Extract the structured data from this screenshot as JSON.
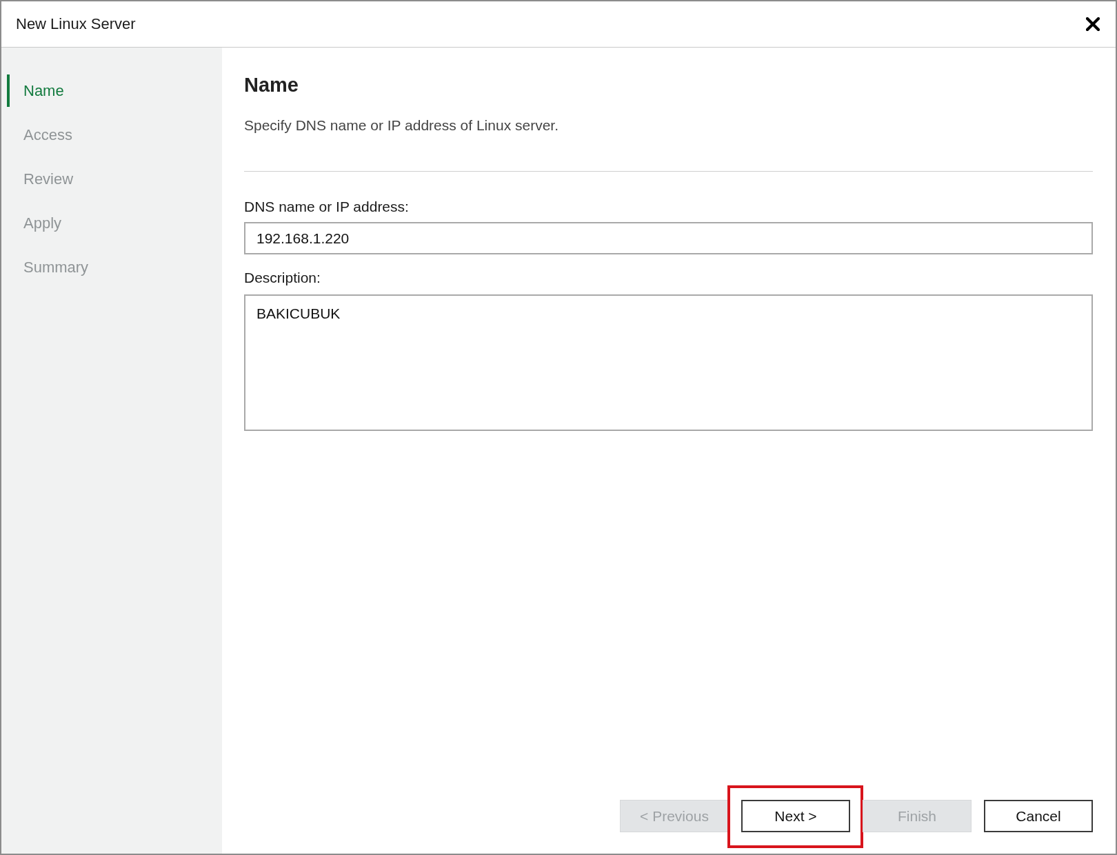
{
  "window": {
    "title": "New Linux Server"
  },
  "steps": [
    {
      "label": "Name",
      "selected": true
    },
    {
      "label": "Access",
      "selected": false
    },
    {
      "label": "Review",
      "selected": false
    },
    {
      "label": "Apply",
      "selected": false
    },
    {
      "label": "Summary",
      "selected": false
    }
  ],
  "page": {
    "heading": "Name",
    "description": "Specify DNS name or IP address of Linux server."
  },
  "fields": [
    {
      "kind": "input",
      "label": "DNS name or IP address:",
      "value": "192.168.1.220"
    },
    {
      "kind": "textarea",
      "label": "Description:",
      "value": "BAKICUBUK"
    }
  ],
  "buttons": [
    {
      "label": "< Previous",
      "disabled": true,
      "highlighted": false
    },
    {
      "label": "Next >",
      "disabled": false,
      "highlighted": true
    },
    {
      "label": "Finish",
      "disabled": true,
      "highlighted": false
    },
    {
      "label": "Cancel",
      "disabled": false,
      "highlighted": false
    }
  ]
}
